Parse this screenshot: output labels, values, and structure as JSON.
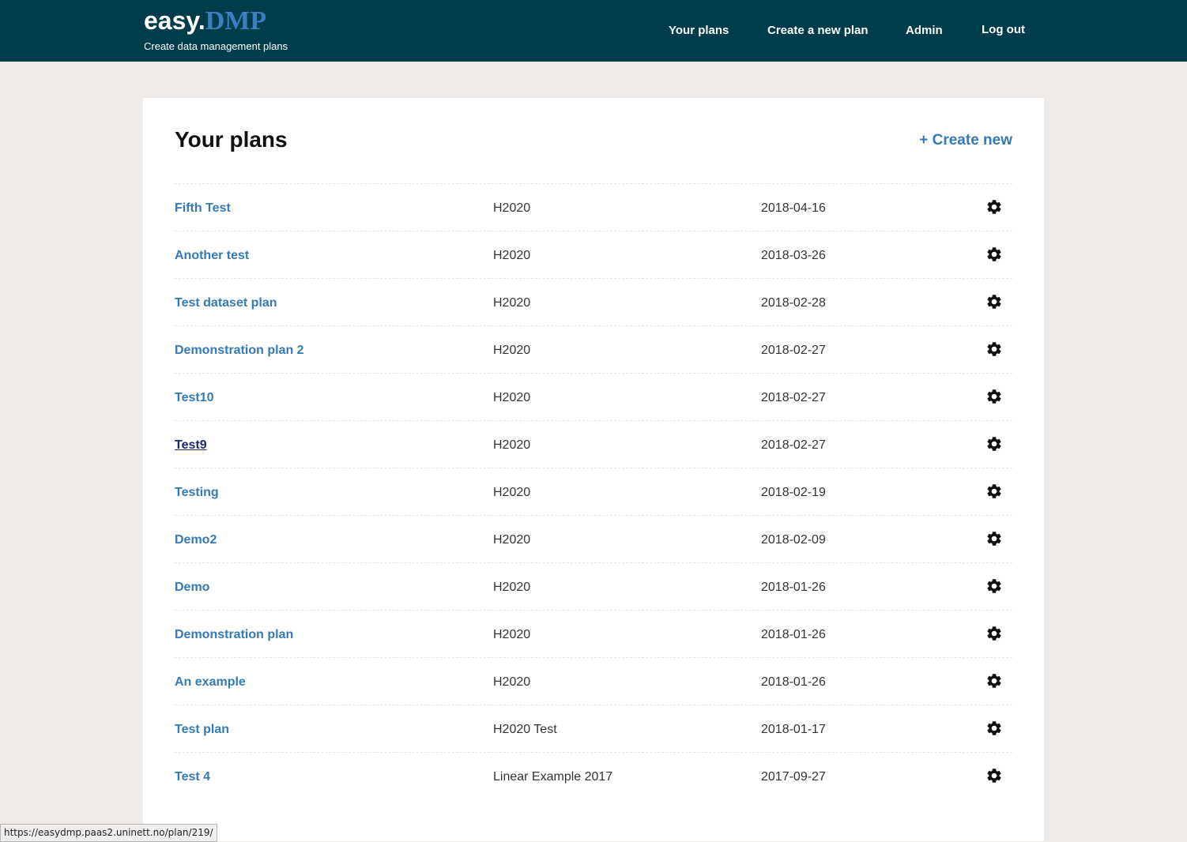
{
  "header": {
    "brand_prefix": "easy.",
    "brand_suffix": "DMP",
    "tagline": "Create data management plans",
    "nav": {
      "your_plans": "Your plans",
      "create_plan": "Create a new plan",
      "admin": "Admin",
      "logout": "Log out"
    }
  },
  "main": {
    "title": "Your plans",
    "create_new": "+ Create new",
    "plans": [
      {
        "name": "Fifth Test",
        "template": "H2020",
        "date": "2018-04-16"
      },
      {
        "name": "Another test",
        "template": "H2020",
        "date": "2018-03-26"
      },
      {
        "name": "Test dataset plan",
        "template": "H2020",
        "date": "2018-02-28"
      },
      {
        "name": "Demonstration plan 2",
        "template": "H2020",
        "date": "2018-02-27"
      },
      {
        "name": "Test10",
        "template": "H2020",
        "date": "2018-02-27"
      },
      {
        "name": "Test9",
        "template": "H2020",
        "date": "2018-02-27"
      },
      {
        "name": "Testing",
        "template": "H2020",
        "date": "2018-02-19"
      },
      {
        "name": "Demo2",
        "template": "H2020",
        "date": "2018-02-09"
      },
      {
        "name": "Demo",
        "template": "H2020",
        "date": "2018-01-26"
      },
      {
        "name": "Demonstration plan",
        "template": "H2020",
        "date": "2018-01-26"
      },
      {
        "name": "An example",
        "template": "H2020",
        "date": "2018-01-26"
      },
      {
        "name": "Test plan",
        "template": "H2020 Test",
        "date": "2018-01-17"
      },
      {
        "name": "Test 4",
        "template": "Linear Example 2017",
        "date": "2017-09-27"
      }
    ],
    "row_action_icon": "gear-icon"
  },
  "status_bar": {
    "url": "https://easydmp.paas2.uninett.no/plan/219/"
  },
  "colors": {
    "header_bg": "#003d4a",
    "page_bg": "#efebe8",
    "link": "#337ab7",
    "link_hover": "#1a2a6e"
  }
}
